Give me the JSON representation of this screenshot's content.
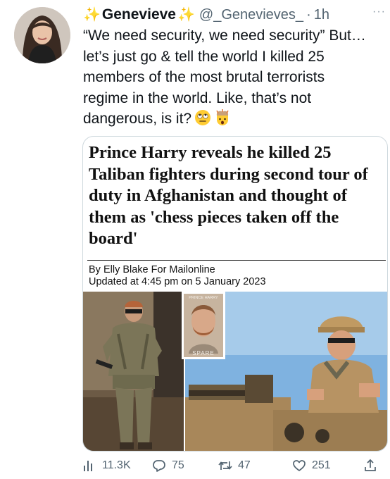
{
  "tweet": {
    "display_name": "Genevieve",
    "handle": "@_Genevieves_",
    "separator": "·",
    "time": "1h",
    "more": "···",
    "text": "“We need security, we need security” But…\nlet’s just go & tell the world I killed 25\nmembers of the most brutal terrorists\nregime in the world. Like, that’s not\ndangerous, is it?",
    "emojis": [
      "face-with-rolling-eyes-emoji",
      "exploding-head-emoji"
    ]
  },
  "card": {
    "headline": "Prince Harry reveals he killed 25 Taliban fighters during second tour of duty in Afghanistan and thought of them as 'chess pieces taken off the board'",
    "byline": "By Elly Blake For Mailonline",
    "updated": "Updated at 4:45 pm on 5 January 2023",
    "book_author": "PRINCE HARRY",
    "book_title": "SPARE"
  },
  "actions": {
    "views": "11.3K",
    "replies": "75",
    "retweets": "47",
    "likes": "251"
  },
  "colors": {
    "text": "#0f1419",
    "secondary": "#536471",
    "border": "#cfd9de",
    "sparkle": "#f5c518"
  }
}
